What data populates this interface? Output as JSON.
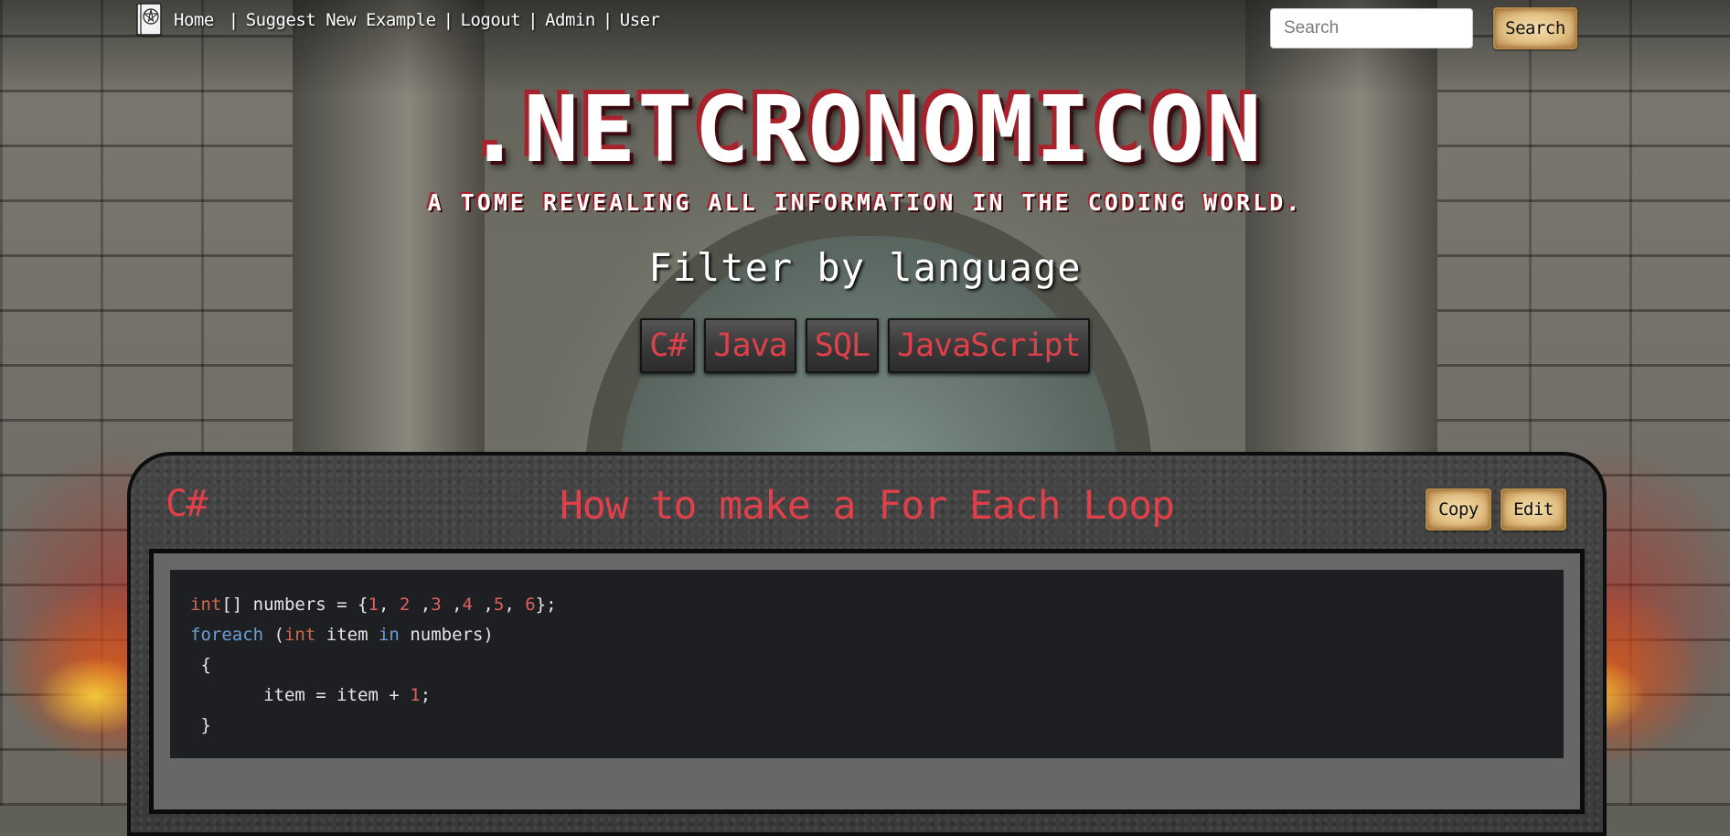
{
  "nav": {
    "logo_icon": "book-pentagram-icon",
    "links": [
      {
        "label": "Home"
      },
      {
        "label": "Suggest New Example"
      },
      {
        "label": "Logout"
      },
      {
        "label": "Admin"
      },
      {
        "label": "User"
      }
    ],
    "separator": "|"
  },
  "search": {
    "placeholder": "Search",
    "value": "",
    "button_label": "Search"
  },
  "header": {
    "title": ".NETCRONOMICON",
    "tagline": "A TOME REVEALING ALL INFORMATION IN THE CODING WORLD.",
    "filter_label": "Filter by language",
    "filters": [
      {
        "label": "C#"
      },
      {
        "label": "Java"
      },
      {
        "label": "SQL"
      },
      {
        "label": "JavaScript"
      }
    ]
  },
  "card": {
    "language": "C#",
    "title": "How to make a For Each Loop",
    "copy_label": "Copy",
    "edit_label": "Edit",
    "code_lines": [
      "int[] numbers = {1, 2 ,3 ,4 ,5, 6};",
      "foreach (int item in numbers)",
      " {",
      "       item = item + 1;",
      " }"
    ]
  },
  "colors": {
    "accent_red": "#e0404a",
    "title_red_shadow": "#a8212b",
    "parchment": "#e2bf83",
    "code_bg": "#1e1f22"
  }
}
